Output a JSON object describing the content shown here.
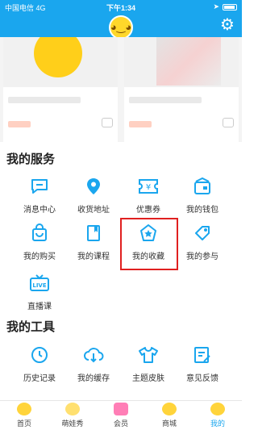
{
  "status_bar": {
    "carrier": "中国电信  4G",
    "time": "下午1:34",
    "battery": ""
  },
  "accent_color": "#1aa6ee",
  "highlight_color": "#e02020",
  "services": {
    "title": "我的服务",
    "items": [
      {
        "label": "消息中心",
        "icon": "message-icon"
      },
      {
        "label": "收货地址",
        "icon": "location-pin-icon"
      },
      {
        "label": "优惠券",
        "icon": "coupon-icon"
      },
      {
        "label": "我的钱包",
        "icon": "wallet-icon"
      },
      {
        "label": "我的购买",
        "icon": "shopping-bag-icon"
      },
      {
        "label": "我的课程",
        "icon": "course-icon"
      },
      {
        "label": "我的收藏",
        "icon": "favorite-icon"
      },
      {
        "label": "我的参与",
        "icon": "tag-icon"
      },
      {
        "label": "直播课",
        "icon": "live-icon"
      }
    ]
  },
  "tools": {
    "title": "我的工具",
    "items": [
      {
        "label": "历史记录",
        "icon": "history-icon"
      },
      {
        "label": "我的缓存",
        "icon": "download-icon"
      },
      {
        "label": "主题皮肤",
        "icon": "theme-icon"
      },
      {
        "label": "意见反馈",
        "icon": "feedback-icon"
      }
    ]
  },
  "tabbar": {
    "tabs": [
      {
        "label": "首页"
      },
      {
        "label": "萌娃秀"
      },
      {
        "label": "会员"
      },
      {
        "label": "商城"
      },
      {
        "label": "我的"
      }
    ],
    "active": "我的"
  }
}
